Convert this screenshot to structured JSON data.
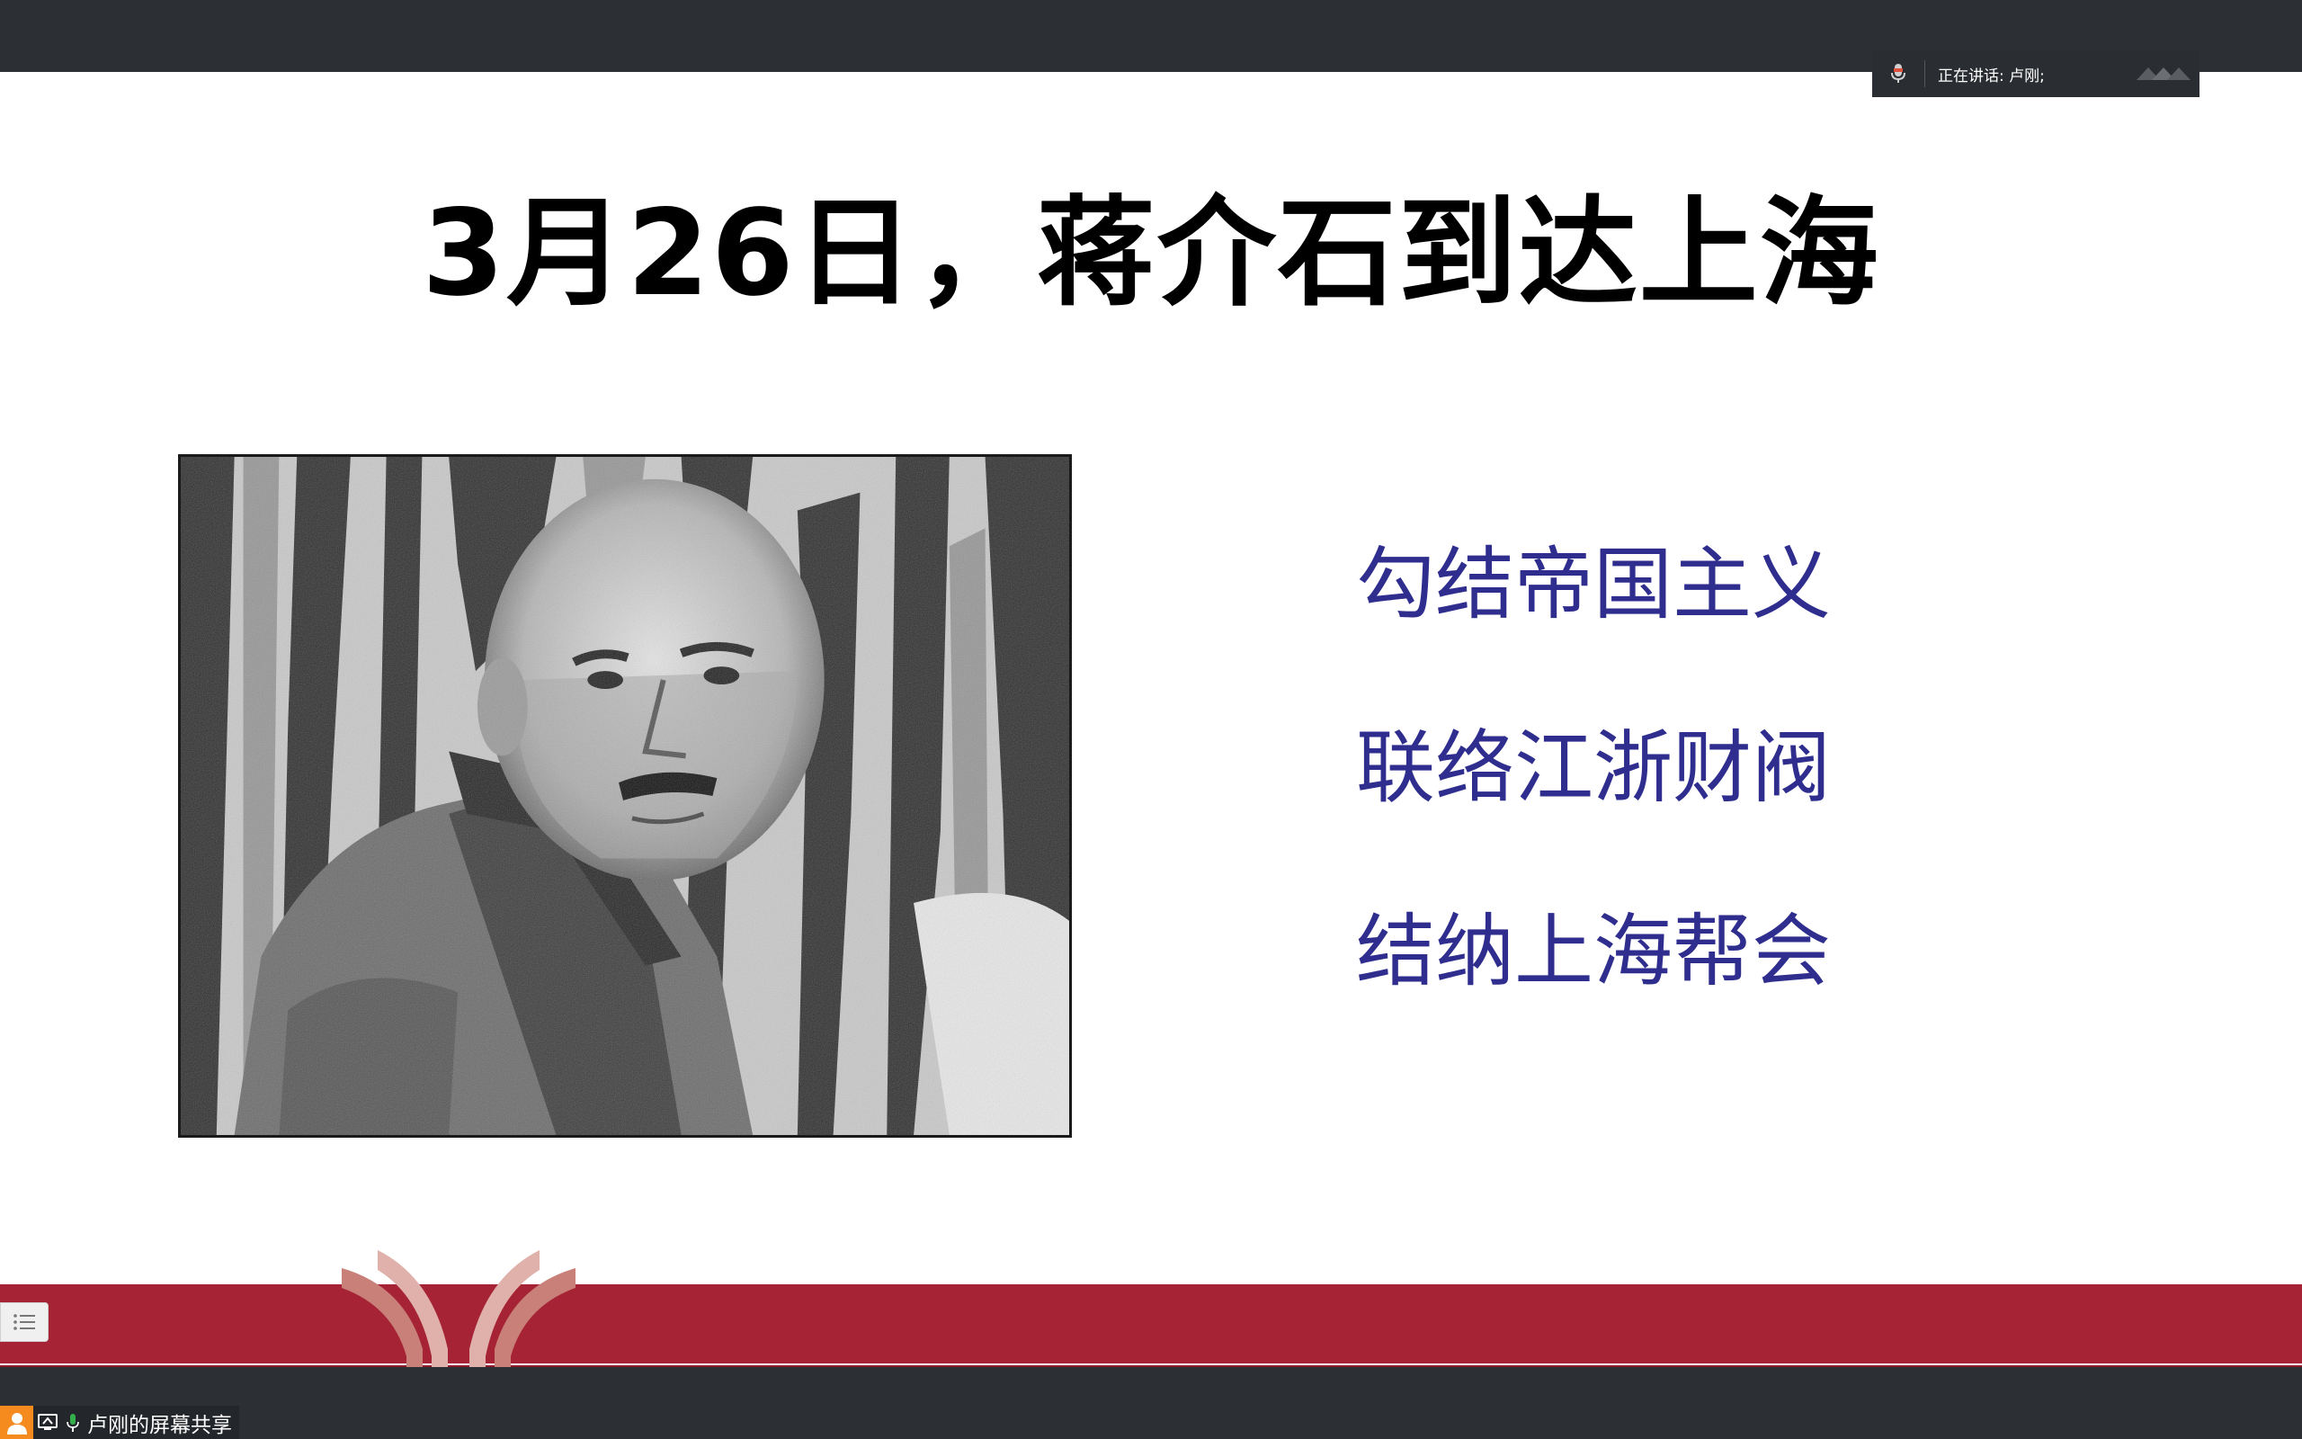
{
  "speaker_panel": {
    "label": "正在讲话: 卢刚;"
  },
  "slide": {
    "title": "3月26日，蒋介石到达上海",
    "bullets": [
      "勾结帝国主义",
      "联络江浙财阀",
      "结纳上海帮会"
    ]
  },
  "share": {
    "label": "卢刚的屏幕共享"
  },
  "icons": {
    "mic": "microphone-icon",
    "toolbar": "toolbar-icon",
    "menu": "list-menu-icon",
    "avatar": "person-icon",
    "screen": "screen-share-icon"
  },
  "colors": {
    "bullet_text": "#2f2e8f",
    "red_band": "#a52335",
    "logo_arc": "#c98079",
    "avatar_bg": "#f58a1f",
    "chrome_bg": "#2c2f33"
  }
}
